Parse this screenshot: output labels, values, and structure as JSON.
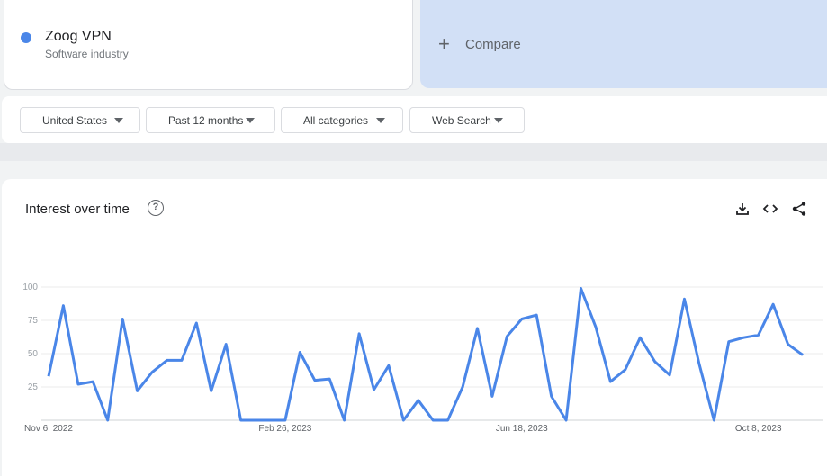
{
  "term": {
    "name": "Zoog VPN",
    "category": "Software industry",
    "color": "#4a86e8"
  },
  "compare": {
    "label": "Compare"
  },
  "filters": [
    {
      "label": "United States"
    },
    {
      "label": "Past 12 months"
    },
    {
      "label": "All categories"
    },
    {
      "label": "Web Search"
    }
  ],
  "chart_panel": {
    "title": "Interest over time"
  },
  "chart_data": {
    "type": "line",
    "ylim": [
      0,
      100
    ],
    "yticks": [
      25,
      50,
      75,
      100
    ],
    "xtick_labels": [
      "Nov 6, 2022",
      "Feb 26, 2023",
      "Jun 18, 2023",
      "Oct 8, 2023"
    ],
    "xtick_indices": [
      0,
      16,
      32,
      48
    ],
    "grid": true,
    "series": [
      {
        "color": "#4a86e8",
        "values": [
          33,
          86,
          27,
          29,
          0,
          76,
          22,
          36,
          45,
          45,
          73,
          22,
          57,
          0,
          0,
          0,
          0,
          51,
          30,
          31,
          0,
          65,
          23,
          41,
          0,
          15,
          0,
          0,
          25,
          69,
          18,
          63,
          76,
          79,
          18,
          0,
          99,
          70,
          29,
          38,
          62,
          44,
          34,
          91,
          42,
          0,
          59,
          62,
          64,
          87,
          57,
          49
        ]
      }
    ]
  }
}
